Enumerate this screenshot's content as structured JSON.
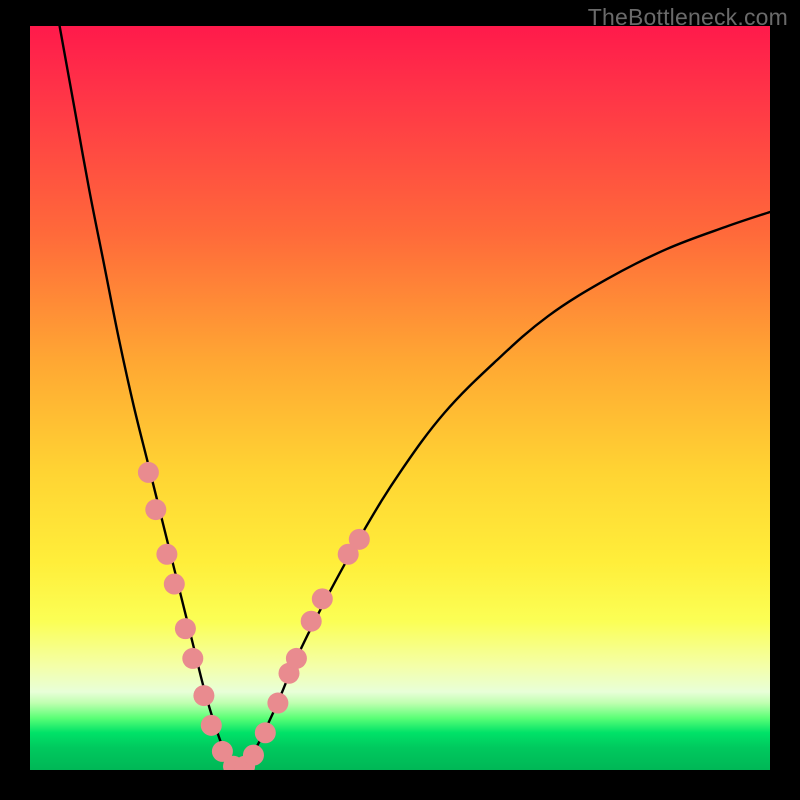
{
  "watermark": "TheBottleneck.com",
  "colors": {
    "background": "#000000",
    "gradient_top": "#ff1a4b",
    "gradient_mid": "#ffd433",
    "gradient_bottom": "#00b756",
    "curve": "#000000",
    "dot_fill": "#e98b8f",
    "dot_stroke": "#d97a80"
  },
  "chart_data": {
    "type": "line",
    "title": "",
    "xlabel": "",
    "ylabel": "",
    "xlim": [
      0,
      100
    ],
    "ylim": [
      0,
      100
    ],
    "grid": false,
    "legend": false,
    "series": [
      {
        "name": "bottleneck-curve",
        "x": [
          4,
          6,
          8,
          10,
          12,
          14,
          16,
          18,
          20,
          22,
          23.5,
          25,
          26.5,
          28,
          30,
          33,
          36,
          40,
          45,
          50,
          56,
          63,
          70,
          78,
          86,
          94,
          100
        ],
        "y": [
          100,
          89,
          78,
          68,
          58,
          49,
          41,
          33,
          25,
          17,
          11,
          6,
          2,
          0,
          2,
          8,
          15,
          23,
          32,
          40,
          48,
          55,
          61,
          66,
          70,
          73,
          75
        ]
      }
    ],
    "points": [
      {
        "name": "left-arm-dot",
        "x": 16.0,
        "y": 40
      },
      {
        "name": "left-arm-dot",
        "x": 17.0,
        "y": 35
      },
      {
        "name": "left-arm-dot",
        "x": 18.5,
        "y": 29
      },
      {
        "name": "left-arm-dot",
        "x": 19.5,
        "y": 25
      },
      {
        "name": "left-arm-dot",
        "x": 21.0,
        "y": 19
      },
      {
        "name": "left-arm-dot",
        "x": 22.0,
        "y": 15
      },
      {
        "name": "left-arm-dot",
        "x": 23.5,
        "y": 10
      },
      {
        "name": "left-arm-dot",
        "x": 24.5,
        "y": 6
      },
      {
        "name": "valley-dot",
        "x": 26.0,
        "y": 2.5
      },
      {
        "name": "valley-dot",
        "x": 27.5,
        "y": 0.5
      },
      {
        "name": "valley-dot",
        "x": 29.0,
        "y": 0.5
      },
      {
        "name": "valley-dot",
        "x": 30.2,
        "y": 2.0
      },
      {
        "name": "right-arm-dot",
        "x": 31.8,
        "y": 5.0
      },
      {
        "name": "right-arm-dot",
        "x": 33.5,
        "y": 9.0
      },
      {
        "name": "right-arm-dot",
        "x": 35.0,
        "y": 13
      },
      {
        "name": "right-arm-dot",
        "x": 36.0,
        "y": 15
      },
      {
        "name": "right-arm-dot",
        "x": 38.0,
        "y": 20
      },
      {
        "name": "right-arm-dot",
        "x": 39.5,
        "y": 23
      },
      {
        "name": "right-arm-dot",
        "x": 43.0,
        "y": 29
      },
      {
        "name": "right-arm-dot",
        "x": 44.5,
        "y": 31
      }
    ]
  }
}
